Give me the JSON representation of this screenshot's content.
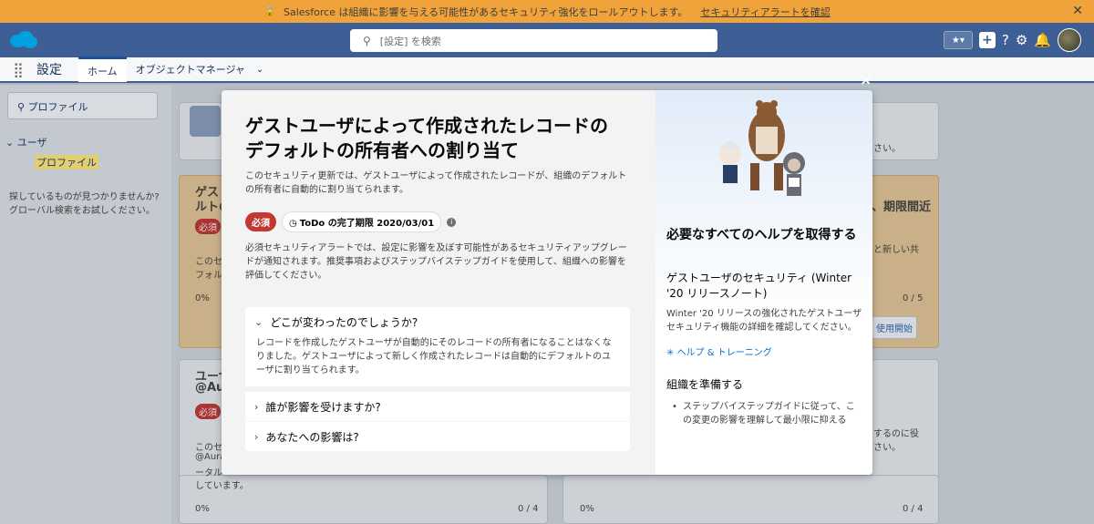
{
  "banner": {
    "lock_icon": "lock-icon",
    "message": "Salesforce は組織に影響を与える可能性があるセキュリティ強化をロールアウトします。",
    "link": "セキュリティアラートを確認",
    "close": "✕"
  },
  "header": {
    "search_placeholder": "[設定] を検索",
    "icons": [
      "star-icon",
      "add-icon",
      "help-icon",
      "gear-icon",
      "bell-icon",
      "avatar"
    ]
  },
  "nav": {
    "app_name": "設定",
    "tabs": [
      {
        "label": "ホーム"
      },
      {
        "label": "オブジェクトマネージャ"
      }
    ]
  },
  "sidebar": {
    "search_value": "プロファイル",
    "tree_parent": "ユーザ",
    "tree_child": "プロファイル",
    "help_line1": "探しているものが見つかりませんか?",
    "help_line2": "グローバル検索をお試しください。"
  },
  "background": {
    "frag1": "ゲス",
    "frag2": "ルトの",
    "frag3": "必須",
    "frag4": "このセ",
    "frag5": "フォル",
    "frag6": "0%",
    "frag7": "ユーザ",
    "frag8": "@Aur",
    "frag9": "必須",
    "frag10": "このセ",
    "frag11": "@Aura",
    "frag12": "ータル",
    "frag13": "しています。",
    "frag14": "0%",
    "frag15": "0 / 4",
    "frag16": "0%",
    "frag17": "0 / 4",
    "frag18": "さい。",
    "frag19": "、期限間近",
    "frag20": "と新しい共",
    "frag21": "0 / 5",
    "frag22": "使用開始",
    "frag23": "するのに役",
    "frag24": "さい。"
  },
  "modal": {
    "close": "×",
    "title_line1": "ゲストユーザによって作成されたレコードの",
    "title_line2": "デフォルトの所有者への割り当て",
    "description": "このセキュリティ更新では、ゲストユーザによって作成されたレコードが、組織のデフォルトの所有者に自動的に割り当てられます。",
    "badge_required": "必須",
    "badge_due": "ToDo の完了期限 2020/03/01",
    "body": "必須セキュリティアラートでは、設定に影響を及ぼす可能性があるセキュリティアップグレードが通知されます。推奨事項およびステップバイステップガイドを使用して、組織への影響を評価してください。",
    "accordion": [
      {
        "title": "どこが変わったのでしょうか?",
        "body": "レコードを作成したゲストユーザが自動的にそのレコードの所有者になることはなくなりました。ゲストユーザによって新しく作成されたレコードは自動的にデフォルトのユーザに割り当てられます。"
      },
      {
        "title": "誰が影響を受けますか?"
      },
      {
        "title": "あなたへの影響は?"
      }
    ],
    "right": {
      "heading": "必要なすべてのヘルプを取得する",
      "subheading": "ゲストユーザのセキュリティ (Winter '20 リリースノート)",
      "text": "Winter '20 リリースの強化されたゲストユーザセキュリティ機能の詳細を確認してください。",
      "link": "ヘルプ & トレーニング",
      "prep_heading": "組織を準備する",
      "prep_item": "ステップバイステップガイドに従って、この変更の影響を理解して最小限に抑える"
    }
  }
}
